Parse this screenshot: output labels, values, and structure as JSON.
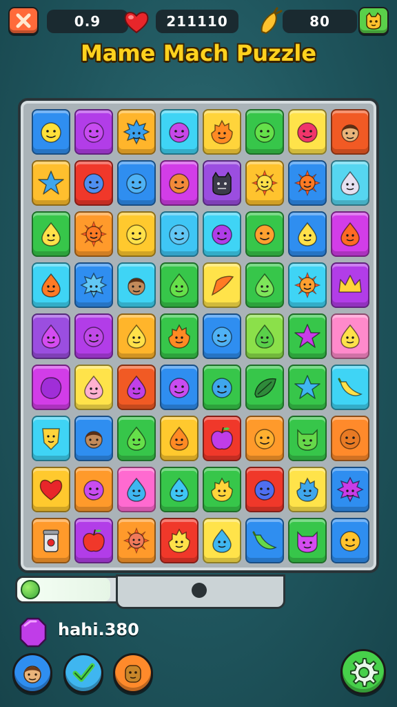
{
  "topbar": {
    "timer_value": "0.9",
    "score_value": "211110",
    "coins_value": "80",
    "icons": {
      "close": "close-icon",
      "heart": "heart-icon",
      "coin": "carrot-coin-icon",
      "profile": "cat-face-icon"
    }
  },
  "title": "Mame Mach Puzzle",
  "board": {
    "rows": [
      [
        {
          "color": "#2f8ef0",
          "shape": "face",
          "fg": "#ffe03a"
        },
        {
          "color": "#b23de8",
          "shape": "face",
          "fg": "#c84cf0"
        },
        {
          "color": "#ffb52b",
          "shape": "spiky",
          "fg": "#3aa0ee"
        },
        {
          "color": "#3fd4f5",
          "shape": "face",
          "fg": "#c648e8"
        },
        {
          "color": "#ffd43b",
          "shape": "fire",
          "fg": "#ff8a24"
        },
        {
          "color": "#37c64a",
          "shape": "face",
          "fg": "#66e04a"
        },
        {
          "color": "#ffe34a",
          "shape": "face",
          "fg": "#f0356a"
        },
        {
          "color": "#f15a24",
          "shape": "person",
          "fg": "#e9b47a"
        }
      ],
      [
        {
          "color": "#ffbf2e",
          "shape": "star",
          "fg": "#3fa6ec"
        },
        {
          "color": "#f0382a",
          "shape": "face",
          "fg": "#4f8ff0"
        },
        {
          "color": "#2f8ef0",
          "shape": "face",
          "fg": "#4fb2f5"
        },
        {
          "color": "#d23de8",
          "shape": "face",
          "fg": "#f28a3a"
        },
        {
          "color": "#9b4ee0",
          "shape": "monster",
          "fg": "#3b3b4a"
        },
        {
          "color": "#ffc32e",
          "shape": "sun",
          "fg": "#ffe14a"
        },
        {
          "color": "#2f8ef0",
          "shape": "sun",
          "fg": "#ff7a24"
        },
        {
          "color": "#56d6f0",
          "shape": "drop",
          "fg": "#e6e0f0"
        }
      ],
      [
        {
          "color": "#37c64a",
          "shape": "drop",
          "fg": "#ffe14a"
        },
        {
          "color": "#ff9a2b",
          "shape": "sun",
          "fg": "#ff7a24"
        },
        {
          "color": "#ffc92e",
          "shape": "face",
          "fg": "#ffe14a"
        },
        {
          "color": "#3fc6f5",
          "shape": "face",
          "fg": "#62c7f5"
        },
        {
          "color": "#3fd4f5",
          "shape": "face",
          "fg": "#b03de8"
        },
        {
          "color": "#37c64a",
          "shape": "face",
          "fg": "#ffa030"
        },
        {
          "color": "#2f8ef0",
          "shape": "drop",
          "fg": "#ffe14a"
        },
        {
          "color": "#d23de8",
          "shape": "drop",
          "fg": "#ff6a24"
        }
      ],
      [
        {
          "color": "#3fd4f5",
          "shape": "drop",
          "fg": "#ff7a24"
        },
        {
          "color": "#2f8ef0",
          "shape": "spiky",
          "fg": "#62c7f5"
        },
        {
          "color": "#3fd4f5",
          "shape": "person",
          "fg": "#c28a5a"
        },
        {
          "color": "#37c64a",
          "shape": "drop",
          "fg": "#66e04a"
        },
        {
          "color": "#ffe34a",
          "shape": "leaf",
          "fg": "#ff7a24"
        },
        {
          "color": "#37c64a",
          "shape": "drop",
          "fg": "#7ee65a"
        },
        {
          "color": "#3fd4f5",
          "shape": "sun",
          "fg": "#ffa030"
        },
        {
          "color": "#b23de8",
          "shape": "crown",
          "fg": "#ffd43b"
        }
      ],
      [
        {
          "color": "#9b4ee0",
          "shape": "drop",
          "fg": "#d44cf0"
        },
        {
          "color": "#b23de8",
          "shape": "face",
          "fg": "#c04ae8"
        },
        {
          "color": "#ffb52b",
          "shape": "drop",
          "fg": "#ffe14a"
        },
        {
          "color": "#37c64a",
          "shape": "fire",
          "fg": "#ff8a24"
        },
        {
          "color": "#2f8ef0",
          "shape": "face",
          "fg": "#4fb2f5"
        },
        {
          "color": "#8be04a",
          "shape": "drop",
          "fg": "#5ad04a"
        },
        {
          "color": "#37c64a",
          "shape": "star",
          "fg": "#c83de8"
        },
        {
          "color": "#ff8acb",
          "shape": "drop",
          "fg": "#ffe14a"
        }
      ],
      [
        {
          "color": "#d23de8",
          "shape": "blob",
          "fg": "#a02ed8"
        },
        {
          "color": "#ffe34a",
          "shape": "drop",
          "fg": "#ffb0d0"
        },
        {
          "color": "#f15a24",
          "shape": "drop",
          "fg": "#c040e8"
        },
        {
          "color": "#2f8ef0",
          "shape": "face",
          "fg": "#c84cf0"
        },
        {
          "color": "#37c64a",
          "shape": "face",
          "fg": "#3fa6ec"
        },
        {
          "color": "#37c64a",
          "shape": "leaf2",
          "fg": "#2f8a3a"
        },
        {
          "color": "#37c64a",
          "shape": "star",
          "fg": "#3fb6f0"
        },
        {
          "color": "#3fd4f5",
          "shape": "banana",
          "fg": "#ffe14a"
        }
      ],
      [
        {
          "color": "#3fd4f5",
          "shape": "shield",
          "fg": "#ffd43b"
        },
        {
          "color": "#2f8ef0",
          "shape": "person",
          "fg": "#c28a5a"
        },
        {
          "color": "#37c64a",
          "shape": "drop",
          "fg": "#66e04a"
        },
        {
          "color": "#ffc92e",
          "shape": "drop",
          "fg": "#ff8a24"
        },
        {
          "color": "#f0382a",
          "shape": "apple",
          "fg": "#c03de8"
        },
        {
          "color": "#ff9a2b",
          "shape": "face",
          "fg": "#ffb030"
        },
        {
          "color": "#37c64a",
          "shape": "cat",
          "fg": "#66d84a"
        },
        {
          "color": "#ff8a2b",
          "shape": "face",
          "fg": "#e87a24"
        }
      ],
      [
        {
          "color": "#ffc92e",
          "shape": "heart",
          "fg": "#e8262a"
        },
        {
          "color": "#ff9a2b",
          "shape": "face",
          "fg": "#c84cf0"
        },
        {
          "color": "#ff6ad0",
          "shape": "drop",
          "fg": "#3fb6f0"
        },
        {
          "color": "#37c64a",
          "shape": "drop",
          "fg": "#3fc6f5"
        },
        {
          "color": "#37c64a",
          "shape": "fire",
          "fg": "#ffd43b"
        },
        {
          "color": "#f0382a",
          "shape": "face",
          "fg": "#4f6ff0"
        },
        {
          "color": "#ffe34a",
          "shape": "fire",
          "fg": "#3fa6ec"
        },
        {
          "color": "#2f8ef0",
          "shape": "spiky",
          "fg": "#c83de8"
        }
      ],
      [
        {
          "color": "#ff9a2b",
          "shape": "jar",
          "fg": "#e6e6ea"
        },
        {
          "color": "#b23de8",
          "shape": "apple",
          "fg": "#f0382a"
        },
        {
          "color": "#ff9a2b",
          "shape": "sun",
          "fg": "#f07a5a"
        },
        {
          "color": "#f0382a",
          "shape": "fire",
          "fg": "#ffe14a"
        },
        {
          "color": "#ffe34a",
          "shape": "drop",
          "fg": "#3fb6f0"
        },
        {
          "color": "#2f8ef0",
          "shape": "banana",
          "fg": "#66d84a"
        },
        {
          "color": "#37c64a",
          "shape": "cat",
          "fg": "#d44cf0"
        },
        {
          "color": "#2f8ef0",
          "shape": "face",
          "fg": "#ffc32e"
        }
      ]
    ]
  },
  "progress": {
    "fill_fraction": 0.35,
    "icons": {
      "left_orb": "green-orb-icon",
      "slider": "slider-knob-icon"
    }
  },
  "bottom": {
    "gem_label": "hahi.380",
    "icons": {
      "gem": "purple-gem-icon",
      "avatar": "avatar-icon",
      "check": "checkmark-icon",
      "bear": "bear-icon",
      "settings": "gear-icon"
    }
  },
  "colors": {
    "accent_title": "#ffd21e",
    "background": "#1f555d",
    "settings_green": "#47d04a"
  }
}
